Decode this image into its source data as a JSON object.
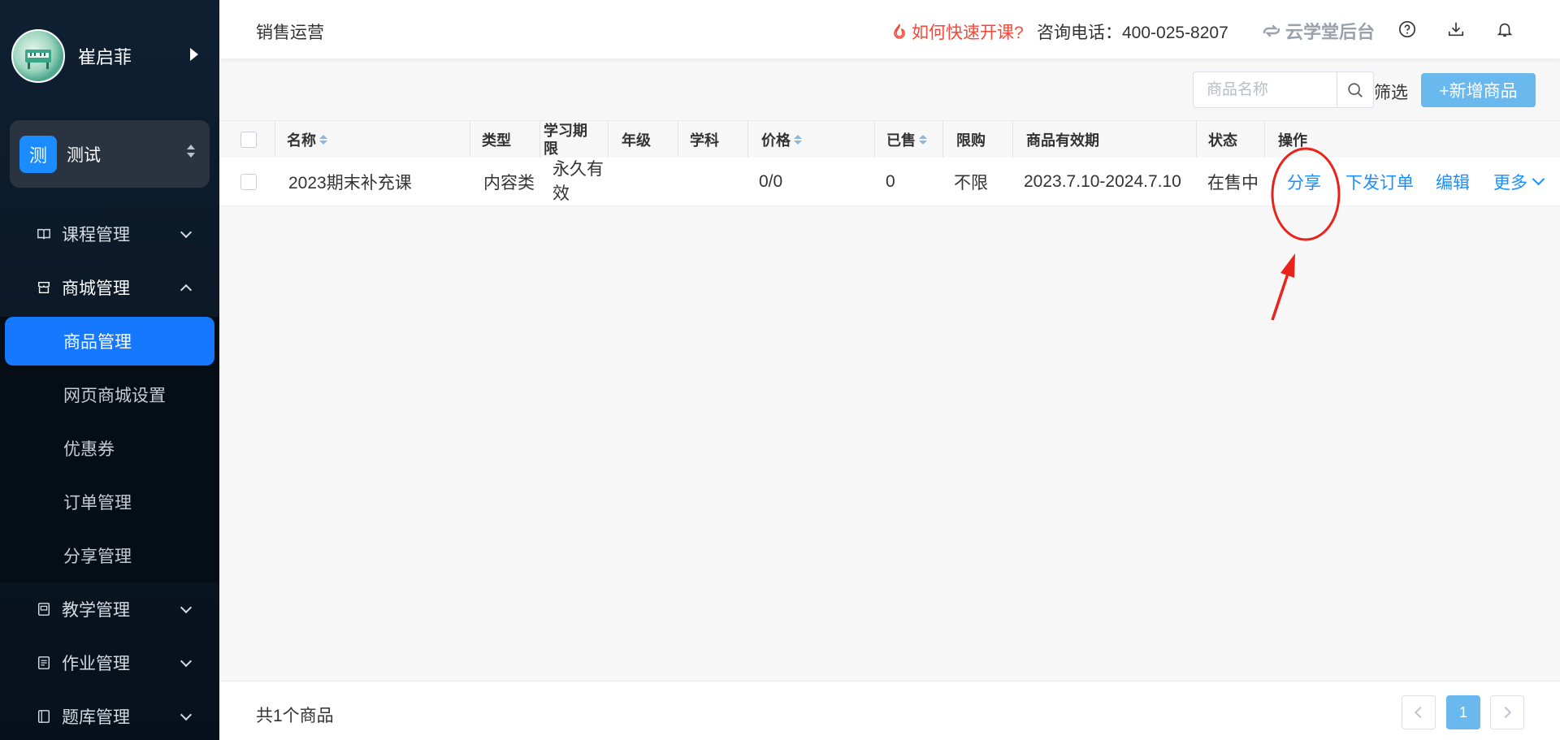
{
  "sidebar": {
    "user_name": "崔启菲",
    "org": {
      "badge": "测",
      "name": "测试"
    },
    "groups": [
      {
        "label": "课程管理",
        "icon": "book-icon"
      },
      {
        "label": "商城管理",
        "icon": "store-icon"
      },
      {
        "label": "教学管理",
        "icon": "teaching-icon"
      },
      {
        "label": "作业管理",
        "icon": "homework-icon"
      },
      {
        "label": "题库管理",
        "icon": "question-bank-icon"
      }
    ],
    "mall_items": [
      "商品管理",
      "网页商城设置",
      "优惠券",
      "订单管理",
      "分享管理"
    ]
  },
  "header": {
    "title": "销售运营",
    "promo": "如何快速开课?",
    "phone": "咨询电话：400-025-8207",
    "brand": "云学堂后台"
  },
  "toolbar": {
    "search_placeholder": "商品名称",
    "filter_label": "筛选",
    "add_label": "+新增商品"
  },
  "table": {
    "headers": {
      "name": "名称",
      "type": "类型",
      "period": "学习期限",
      "grade": "年级",
      "subject": "学科",
      "price": "价格",
      "sold": "已售",
      "limit": "限购",
      "validity": "商品有效期",
      "status": "状态",
      "actions": "操作"
    },
    "rows": [
      {
        "name": "2023期末补充课",
        "type": "内容类",
        "period": "永久有效",
        "grade": "",
        "subject": "",
        "price": "0/0",
        "sold": "0",
        "limit": "不限",
        "validity": "2023.7.10-2024.7.10",
        "status": "在售中",
        "actions": {
          "share": "分享",
          "issue_order": "下发订单",
          "edit": "编辑",
          "more": "更多"
        }
      }
    ]
  },
  "footer": {
    "count": "共1个商品",
    "current_page": "1"
  },
  "colors": {
    "accent": "#1677ff",
    "link": "#1890ff",
    "add_button": "#69b8ee",
    "promo": "#f5483b",
    "annotation": "#e8231a"
  }
}
